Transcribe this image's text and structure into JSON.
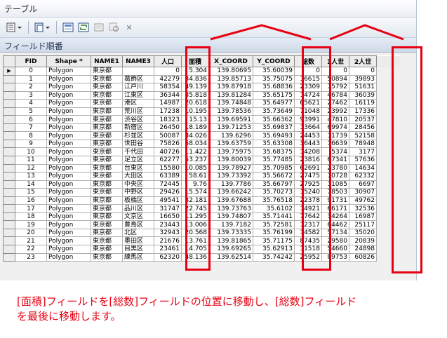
{
  "window": {
    "title": "テーブル"
  },
  "toolbar": {
    "close_label": "✕"
  },
  "field_order_bar": {
    "label": "フィールド順番"
  },
  "table": {
    "headers": [
      "FID",
      "Shape *",
      "NAME1",
      "NAME3",
      "人口",
      "面積",
      "X_COORD",
      "Y_COORD",
      "総数",
      "1人世",
      "2人世"
    ],
    "rows": [
      [
        "0",
        "Polygon",
        "東京都",
        "",
        "0",
        "5.304",
        "139.80695",
        "35.60039",
        "0",
        "0",
        "0"
      ],
      [
        "1",
        "Polygon",
        "東京都",
        "葛飾区",
        "42279",
        "34.836",
        "139.85713",
        "35.75075",
        "16615",
        "50894",
        "39893"
      ],
      [
        "2",
        "Polygon",
        "東京都",
        "江戸川",
        "58354",
        "49.139",
        "139.87918",
        "35.68836",
        "23309",
        "75792",
        "51631"
      ],
      [
        "3",
        "Polygon",
        "東京都",
        "江東区",
        "36344",
        "35.818",
        "139.81284",
        "35.65175",
        "14724",
        "46784",
        "36039"
      ],
      [
        "4",
        "Polygon",
        "東京都",
        "港区",
        "14987",
        "20.618",
        "139.74848",
        "35.64977",
        "65621",
        "27462",
        "16119"
      ],
      [
        "5",
        "Polygon",
        "東京都",
        "荒川区",
        "17238",
        "10.195",
        "139.78536",
        "35.73649",
        "71048",
        "23992",
        "17336"
      ],
      [
        "6",
        "Polygon",
        "東京都",
        "渋谷区",
        "18323",
        "15.13",
        "139.69591",
        "35.66362",
        "93991",
        "47810",
        "20537"
      ],
      [
        "7",
        "Polygon",
        "東京都",
        "新宿区",
        "26450",
        "18.189",
        "139.71253",
        "35.69837",
        "13664",
        "69974",
        "28456"
      ],
      [
        "8",
        "Polygon",
        "東京都",
        "杉並区",
        "50087",
        "34.026",
        "139.6296",
        "35.69493",
        "24453",
        "11739",
        "52158"
      ],
      [
        "9",
        "Polygon",
        "東京都",
        "世田谷",
        "75826",
        "58.034",
        "139.63759",
        "35.63308",
        "36443",
        "16639",
        "78948"
      ],
      [
        "10",
        "Polygon",
        "東京都",
        "千代田",
        "40726",
        "11.422",
        "139.75975",
        "35.68375",
        "14208",
        "5374",
        "3177"
      ],
      [
        "11",
        "Polygon",
        "東京都",
        "足立区",
        "62277",
        "53.237",
        "139.80039",
        "35.77485",
        "23816",
        "67341",
        "57636"
      ],
      [
        "12",
        "Polygon",
        "東京都",
        "台東区",
        "15580",
        "10.085",
        "139.78927",
        "35.70985",
        "62691",
        "23780",
        "14634"
      ],
      [
        "13",
        "Polygon",
        "東京都",
        "大田区",
        "63389",
        "58.61",
        "139.73392",
        "35.56672",
        "27475",
        "10728",
        "62332"
      ],
      [
        "14",
        "Polygon",
        "東京都",
        "中央区",
        "72445",
        "9.76",
        "139.7786",
        "35.66797",
        "27925",
        "11085",
        "6697"
      ],
      [
        "15",
        "Polygon",
        "東京都",
        "中野区",
        "29426",
        "15.574",
        "139.66242",
        "35.70273",
        "15240",
        "78503",
        "30907"
      ],
      [
        "16",
        "Polygon",
        "東京都",
        "板橋区",
        "49541",
        "32.181",
        "139.67688",
        "35.76518",
        "22378",
        "91731",
        "49762"
      ],
      [
        "17",
        "Polygon",
        "東京都",
        "品川区",
        "31747",
        "22.745",
        "139.73763",
        "35.6102",
        "14921",
        "66171",
        "32536"
      ],
      [
        "18",
        "Polygon",
        "東京都",
        "文京区",
        "16650",
        "11.295",
        "139.74807",
        "35.71441",
        "77642",
        "34264",
        "16987"
      ],
      [
        "19",
        "Polygon",
        "東京都",
        "豊島区",
        "23443",
        "13.006",
        "139.7182",
        "35.72581",
        "12317",
        "64462",
        "25117"
      ],
      [
        "20",
        "Polygon",
        "東京都",
        "北区",
        "32943",
        "20.568",
        "139.73335",
        "35.76199",
        "14582",
        "57134",
        "35020"
      ],
      [
        "21",
        "Polygon",
        "東京都",
        "墨田区",
        "21676",
        "13.761",
        "139.81865",
        "35.71175",
        "87435",
        "29580",
        "20839"
      ],
      [
        "22",
        "Polygon",
        "東京都",
        "目黒区",
        "23461",
        "14.705",
        "139.69265",
        "35.62913",
        "11518",
        "54660",
        "24898"
      ],
      [
        "23",
        "Polygon",
        "東京都",
        "練馬区",
        "62320",
        "48.136",
        "139.62514",
        "35.74242",
        "25952",
        "89753",
        "60826"
      ]
    ]
  },
  "instruction": {
    "line1": "[面積]フィールドを[総数]フィールドの位置に移動し、[総数]フィールド",
    "line2": "を最後に移動します。"
  },
  "colors": {
    "annotation_red": "#e60012"
  }
}
